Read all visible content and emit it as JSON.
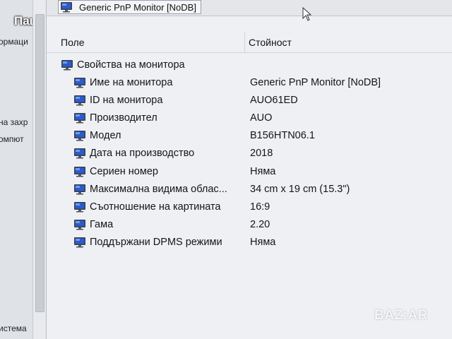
{
  "watermark_user": "Пацо",
  "watermark_site": "BAZ:AR",
  "sidebar_fragments": [
    "ормаци",
    "на захр",
    "омпют",
    "истема"
  ],
  "device_title": "Generic PnP Monitor [NoDB]",
  "columns": {
    "field": "Поле",
    "value": "Стойност"
  },
  "group_label": "Свойства на монитора",
  "rows": [
    {
      "label": "Име на монитора",
      "value": "Generic PnP Monitor [NoDB]"
    },
    {
      "label": "ID на монитора",
      "value": "AUO61ED"
    },
    {
      "label": "Производител",
      "value": "AUO"
    },
    {
      "label": "Модел",
      "value": "B156HTN06.1"
    },
    {
      "label": "Дата на производство",
      "value": "2018"
    },
    {
      "label": "Сериен номер",
      "value": "Няма"
    },
    {
      "label": "Максимална видима облас...",
      "value": "34 cm x 19 cm (15.3\")"
    },
    {
      "label": "Съотношение на картината",
      "value": "16:9"
    },
    {
      "label": "Гама",
      "value": "2.20"
    },
    {
      "label": "Поддържани DPMS режими",
      "value": "Няма"
    }
  ],
  "icon": "monitor-icon",
  "colors": {
    "monitor_screen": "#1f4fbf",
    "monitor_frame": "#3a3f47"
  }
}
